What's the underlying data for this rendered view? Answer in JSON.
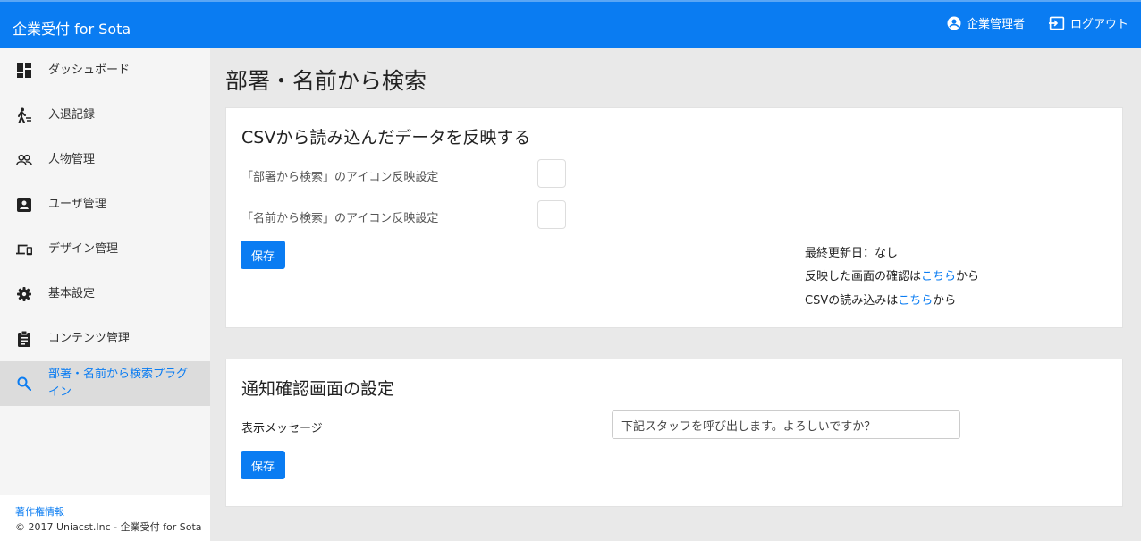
{
  "header": {
    "title": "企業受付 for Sota",
    "user_label": "企業管理者",
    "logout_label": "ログアウト"
  },
  "sidebar": {
    "items": [
      {
        "label": "ダッシュボード",
        "icon": "dashboard-icon"
      },
      {
        "label": "入退記録",
        "icon": "walking-person-icon"
      },
      {
        "label": "人物管理",
        "icon": "people-icon"
      },
      {
        "label": "ユーザ管理",
        "icon": "account-box-icon"
      },
      {
        "label": "デザイン管理",
        "icon": "devices-icon"
      },
      {
        "label": "基本設定",
        "icon": "gear-icon"
      },
      {
        "label": "コンテンツ管理",
        "icon": "clipboard-icon"
      },
      {
        "label": "部署・名前から検索プラグイン",
        "icon": "search-icon",
        "active": true
      }
    ],
    "footer": {
      "copyright_link": "著作権情報",
      "copyright_text": "© 2017 Uniacst.Inc - 企業受付 for Sota"
    }
  },
  "main": {
    "page_title": "部署・名前から検索",
    "csv_card": {
      "title": "CSVから読み込んだデータを反映する",
      "setting_dept_label": "「部署から検索」のアイコン反映設定",
      "setting_name_label": "「名前から検索」のアイコン反映設定",
      "save_label": "保存",
      "last_updated": "最終更新日：なし",
      "confirm_prefix": "反映した画面の確認は",
      "confirm_link": "こちら",
      "confirm_suffix": "から",
      "csv_prefix": "CSVの読み込みは",
      "csv_link": "こちら",
      "csv_suffix": "から"
    },
    "notify_card": {
      "title": "通知確認画面の設定",
      "message_label": "表示メッセージ",
      "message_value": "下記スタッフを呼び出します。よろしいですか？",
      "save_label": "保存"
    }
  },
  "colors": {
    "primary": "#0a7cf2",
    "sidebar_bg": "#f5f5f5",
    "active_bg": "#dcdcdc",
    "page_bg": "#e9e9e9"
  }
}
